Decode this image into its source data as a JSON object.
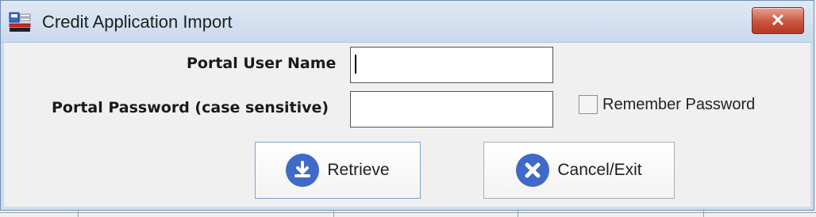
{
  "window": {
    "title": "Credit Application Import",
    "close_label": "✕"
  },
  "form": {
    "username": {
      "label": "Portal User Name",
      "value": "",
      "placeholder": ""
    },
    "password": {
      "label": "Portal Password (case sensitive)",
      "value": "",
      "placeholder": ""
    },
    "remember": {
      "label": "Remember Password",
      "checked": false
    }
  },
  "buttons": {
    "retrieve": "Retrieve",
    "cancel": "Cancel/Exit"
  },
  "colors": {
    "accent_icon": "#3f6ac8",
    "close_red": "#c9543d",
    "titlebar": "#c9d9ec"
  },
  "icons": {
    "app": "app-form-icon",
    "retrieve": "download-arrow-icon",
    "cancel": "x-circle-icon",
    "close": "close-icon"
  }
}
